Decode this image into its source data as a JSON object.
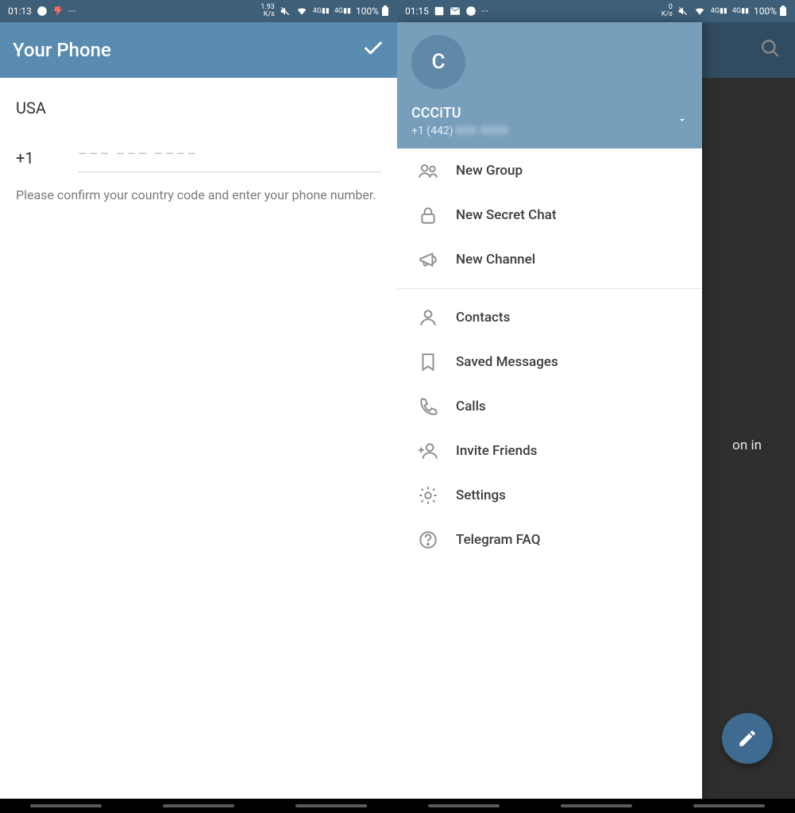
{
  "left": {
    "status": {
      "time": "01:13",
      "speed": "1.93\nK/s",
      "battery": "100%"
    },
    "appbar": {
      "title": "Your Phone"
    },
    "form": {
      "country": "USA",
      "code": "+1",
      "phone_placeholder": "––– ––– ––––",
      "hint": "Please confirm your country code and enter your phone number."
    }
  },
  "right": {
    "status": {
      "time": "01:15",
      "speed": "0\nK/s",
      "battery": "100%"
    },
    "bg_text_fragment": "on in",
    "drawer": {
      "avatar_initial": "C",
      "name": "CCCiTU",
      "phone_visible": "+1 (442)",
      "menu": [
        {
          "key": "new-group",
          "label": "New Group",
          "icon": "group"
        },
        {
          "key": "new-secret-chat",
          "label": "New Secret Chat",
          "icon": "lock"
        },
        {
          "key": "new-channel",
          "label": "New Channel",
          "icon": "megaphone"
        },
        {
          "key": "sep"
        },
        {
          "key": "contacts",
          "label": "Contacts",
          "icon": "person"
        },
        {
          "key": "saved-messages",
          "label": "Saved Messages",
          "icon": "bookmark"
        },
        {
          "key": "calls",
          "label": "Calls",
          "icon": "phone"
        },
        {
          "key": "invite-friends",
          "label": "Invite Friends",
          "icon": "addperson"
        },
        {
          "key": "settings",
          "label": "Settings",
          "icon": "gear"
        },
        {
          "key": "telegram-faq",
          "label": "Telegram FAQ",
          "icon": "help"
        }
      ]
    }
  }
}
